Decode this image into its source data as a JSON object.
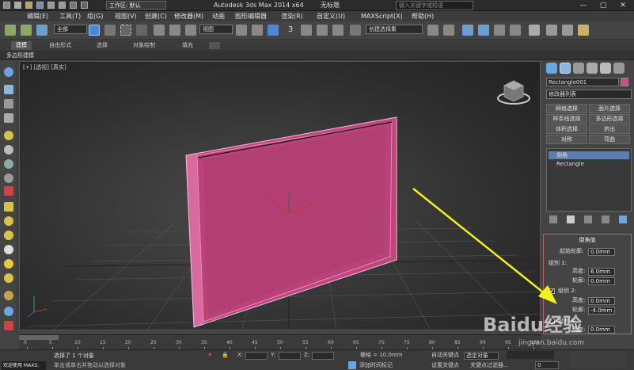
{
  "titlebar": {
    "workspace": "工作区: 默认",
    "app_title": "Autodesk 3ds Max  2014 x64",
    "doc_title": "无标题",
    "search_placeholder": "键入关键字或短语",
    "minimize": "—",
    "maximize": "▢",
    "close": "✕"
  },
  "menu": [
    "编辑(E)",
    "工具(T)",
    "组(G)",
    "视图(V)",
    "创建(C)",
    "修改器(M)",
    "动画",
    "图形编辑器",
    "渲染(R)",
    "自定义(U)",
    "MAXScript(X)",
    "帮助(H)"
  ],
  "toolbar": {
    "selection_filter": "全部",
    "coord_system": "视图",
    "named_selection": "创建选择集",
    "snap_3": "3"
  },
  "ribbon": {
    "tabs": [
      "建模",
      "自由形式",
      "选择",
      "对象绘制",
      "填充"
    ],
    "sub_title": "多边形建模"
  },
  "viewport": {
    "label": "[+] [透视] [真实]"
  },
  "command_panel": {
    "object_name": "Rectangle001",
    "modifier_list": "修改器列表",
    "buttons": [
      "网格选择",
      "面片选择",
      "样条线选择",
      "多边形选择",
      "体积选择",
      "挤出",
      "对称",
      "弯曲"
    ],
    "stack": [
      "倒角",
      "Rectangle"
    ],
    "bevel": {
      "title": "倒角值",
      "start_outline_label": "起始轮廓:",
      "start_outline": "0.0mm",
      "level1_label": "级别 1:",
      "level1_height_label": "高度:",
      "level1_height": "6.0mm",
      "level1_outline_label": "轮廓:",
      "level1_outline": "0.0mm",
      "level2_label": "级别 2:",
      "level2_height_label": "高度:",
      "level2_height": "0.0mm",
      "level2_outline_label": "轮廓:",
      "level2_outline": "-4.0mm",
      "level3_label": "级别 3:",
      "level3_height_label": "高度:",
      "level3_height": "0.0mm",
      "check_mark": "✔"
    }
  },
  "timeline": {
    "frame_display": "0 / 100",
    "ticks": [
      "0",
      "5",
      "10",
      "15",
      "20",
      "25",
      "30",
      "35",
      "40",
      "45",
      "50",
      "55",
      "60",
      "65",
      "70",
      "75",
      "80",
      "85",
      "90",
      "95",
      "100"
    ]
  },
  "status": {
    "maxscript": "欢迎使用 MAXS:",
    "line1": "选择了 1 个对象",
    "line2": "单击或单击并拖动以选择对象",
    "x_label": "X:",
    "y_label": "Y:",
    "z_label": "Z:",
    "grid_label": "栅格 = 10.0mm",
    "add_time_tag": "添加时间标记",
    "auto_key": "自动关键点",
    "selected_obj": "选定对象",
    "set_key": "设置关键点",
    "key_filters": "关键点过滤器...",
    "frame": "0"
  },
  "watermark": {
    "text": "Baidu经验",
    "sub": "jingyan.baidu.com"
  },
  "colors": {
    "object_pink": "#d04c8a",
    "arrow_yellow": "#f2f21a"
  }
}
